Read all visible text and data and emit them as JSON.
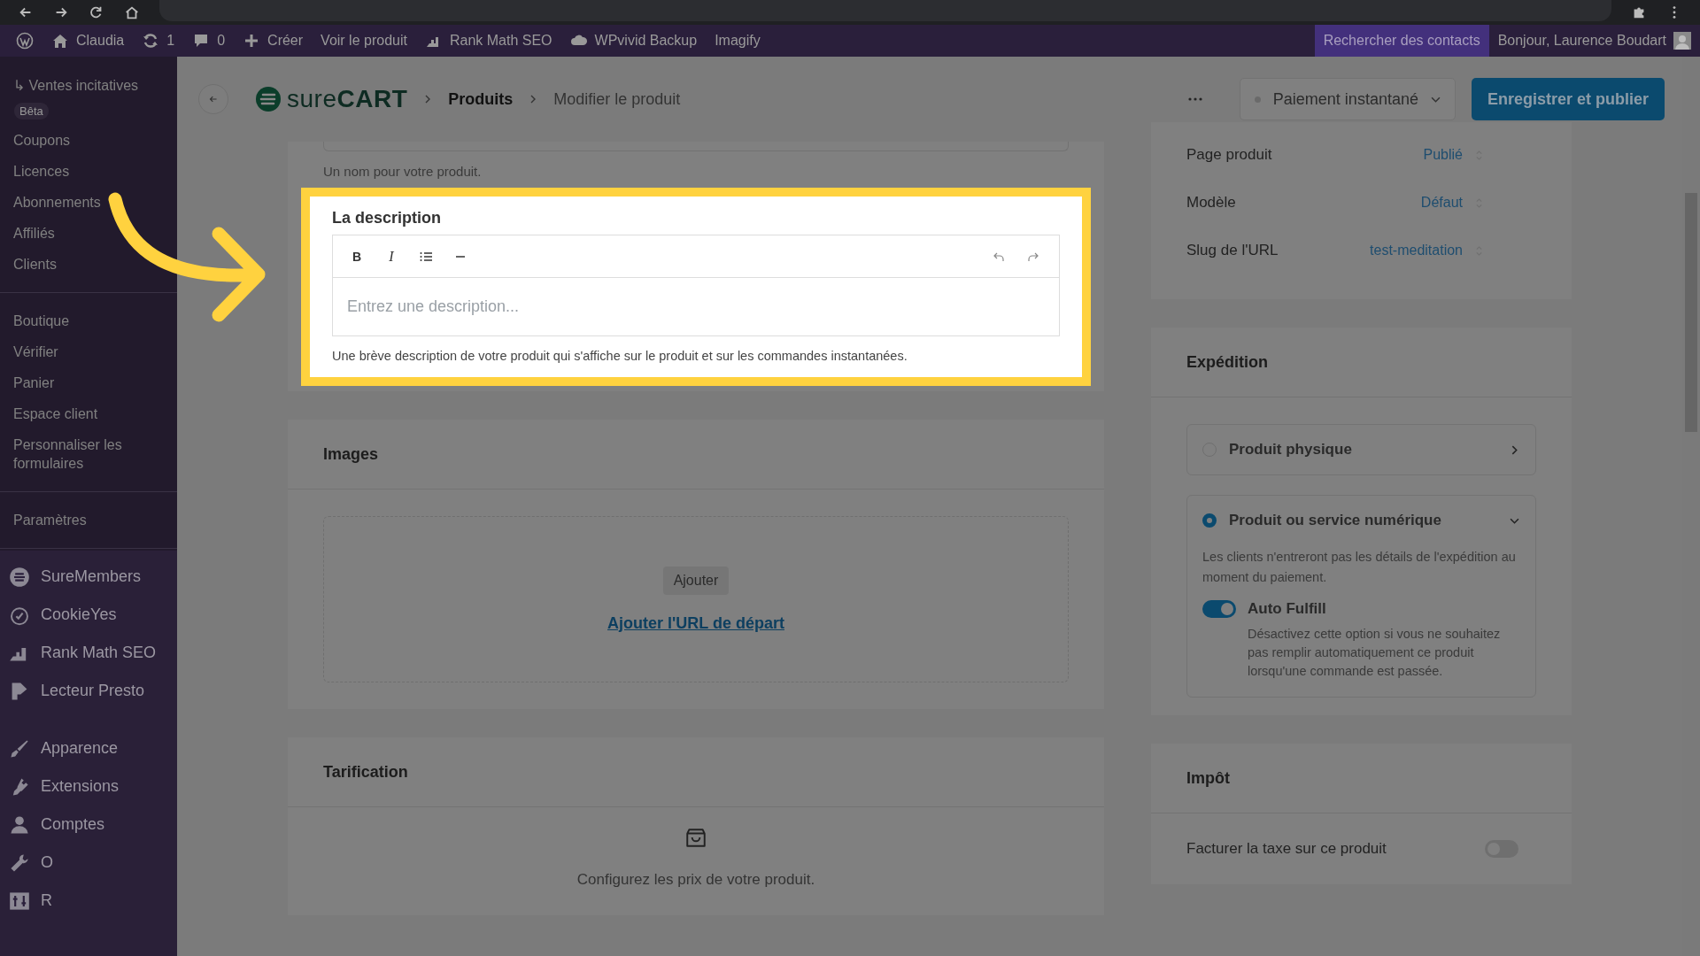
{
  "admin_bar": {
    "items": [
      {
        "kind": "wordpress"
      },
      {
        "kind": "home",
        "label": "Claudia"
      },
      {
        "kind": "updates",
        "label": "1"
      },
      {
        "kind": "comments",
        "label": "0"
      },
      {
        "kind": "new",
        "label": "Créer"
      },
      {
        "kind": "text",
        "label": "Voir le produit"
      },
      {
        "kind": "chart",
        "label": "Rank Math SEO"
      },
      {
        "kind": "cloud",
        "label": "WPvivid Backup"
      },
      {
        "kind": "text",
        "label": "Imagify"
      }
    ],
    "search_contacts": "Rechercher des contacts",
    "greeting": "Bonjour, Laurence Boudart"
  },
  "sidebar": {
    "submenu_groups": [
      [
        {
          "label": "↳ Ventes incitatives",
          "badge": "Bêta"
        },
        {
          "label": "Coupons"
        },
        {
          "label": "Licences"
        },
        {
          "label": "Abonnements"
        },
        {
          "label": "Affiliés"
        },
        {
          "label": "Clients"
        }
      ],
      [
        {
          "label": "Boutique"
        },
        {
          "label": "Vérifier"
        },
        {
          "label": "Panier"
        },
        {
          "label": "Espace client"
        },
        {
          "label": "Personnaliser les formulaires"
        }
      ],
      [
        {
          "label": "Paramètres"
        }
      ]
    ],
    "menu_groups": [
      [
        {
          "kind": "suremembers",
          "label": "SureMembers"
        },
        {
          "kind": "cookie",
          "label": "CookieYes"
        },
        {
          "kind": "chart",
          "label": "Rank Math SEO"
        },
        {
          "kind": "presto",
          "label": "Lecteur Presto"
        }
      ],
      [
        {
          "kind": "brush",
          "label": "Apparence"
        },
        {
          "kind": "plug",
          "label": "Extensions"
        },
        {
          "kind": "user",
          "label": "Comptes"
        },
        {
          "kind": "wrench",
          "label": "O"
        },
        {
          "kind": "sliders",
          "label": "R"
        }
      ]
    ]
  },
  "header": {
    "logo": "sure**CART**",
    "breadcrumb": [
      "Produits",
      "Modifier le produit"
    ],
    "status": "Paiement instantané",
    "primary_button": "Enregistrer et publier"
  },
  "name_hint": "Un nom pour votre produit.",
  "description": {
    "highlighted": true,
    "label": "La description",
    "toolbar": [
      {
        "kind": "bold",
        "label": "B"
      },
      {
        "kind": "italic",
        "label": "I"
      },
      {
        "kind": "list"
      },
      {
        "kind": "rule"
      },
      {
        "kind": "undo"
      },
      {
        "kind": "redo"
      }
    ],
    "placeholder": "Entrez une description...",
    "help": "Une brève description de votre produit qui s'affiche sur le produit et sur les commandes instantanées."
  },
  "images": {
    "title": "Images",
    "button": "Ajouter",
    "link": "Ajouter l'URL de départ"
  },
  "pricing": {
    "title": "Tarification",
    "text": "Configurez les prix de votre produit."
  },
  "settings": [
    {
      "label": "Page produit",
      "value": "Publié"
    },
    {
      "label": "Modèle",
      "value": "Défaut"
    },
    {
      "label": "Slug de l'URL",
      "value": "test-meditation"
    }
  ],
  "shipping": {
    "title": "Expédition",
    "options": [
      {
        "label": "Produit physique",
        "selected": false,
        "expanded": false
      },
      {
        "label": "Produit ou service numérique",
        "selected": true,
        "expanded": true,
        "description": "Les clients n'entreront pas les détails de l'expédition au moment du paiement.",
        "toggle": {
          "label": "Auto Fulfill",
          "on": true,
          "description": "Désactivez cette option si vous ne souhaitez pas remplir automatiquement ce produit lorsqu'une commande est passée."
        }
      }
    ]
  },
  "tax": {
    "title": "Impôt",
    "rows": [
      {
        "label": "Facturer la taxe sur ce produit",
        "on": false
      }
    ]
  }
}
